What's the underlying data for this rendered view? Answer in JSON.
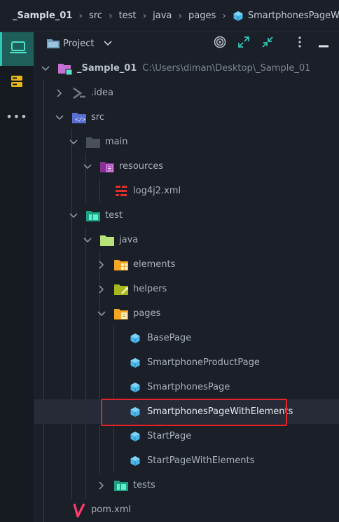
{
  "breadcrumb": {
    "items": [
      "_Sample_01",
      "src",
      "test",
      "java",
      "pages",
      "SmartphonesPageWith"
    ]
  },
  "toolbar": {
    "project_label": "Project"
  },
  "tree": {
    "root": {
      "name": "_Sample_01",
      "path": "C:\\Users\\diman\\Desktop\\_Sample_01"
    },
    "items": [
      {
        "label": ".idea"
      },
      {
        "label": "src"
      },
      {
        "label": "main"
      },
      {
        "label": "resources"
      },
      {
        "label": "log4j2.xml"
      },
      {
        "label": "test"
      },
      {
        "label": "java"
      },
      {
        "label": "elements"
      },
      {
        "label": "helpers"
      },
      {
        "label": "pages"
      },
      {
        "label": "BasePage"
      },
      {
        "label": "SmartphoneProductPage"
      },
      {
        "label": "SmartphonesPage"
      },
      {
        "label": "SmartphonesPageWithElements"
      },
      {
        "label": "StartPage"
      },
      {
        "label": "StartPageWithElements"
      },
      {
        "label": "tests"
      },
      {
        "label": "pom.xml"
      }
    ]
  },
  "colors": {
    "background": "#1b1f27",
    "selection": "#262b37",
    "highlight": "#e0252a",
    "class_icon": "#4bb6e8",
    "folder": "#4a4f5c"
  }
}
